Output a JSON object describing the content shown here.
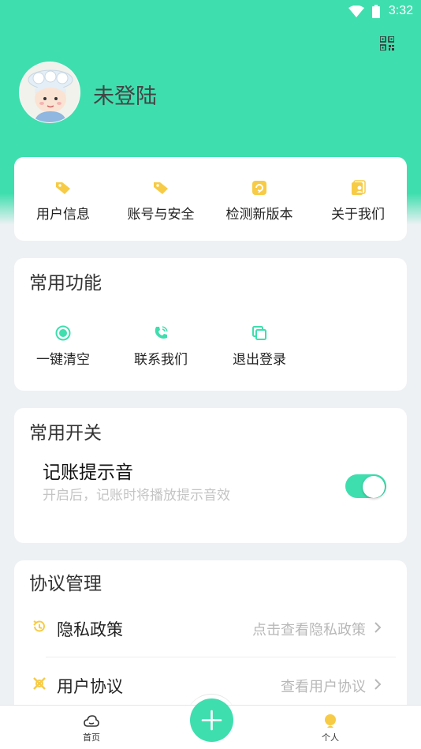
{
  "status_bar": {
    "time": "3:32"
  },
  "profile": {
    "login_status": "未登陆"
  },
  "quick_menu": {
    "items": [
      {
        "label": "用户信息",
        "icon": "tag-icon"
      },
      {
        "label": "账号与安全",
        "icon": "tag-icon"
      },
      {
        "label": "检测新版本",
        "icon": "update-icon"
      },
      {
        "label": "关于我们",
        "icon": "about-icon"
      }
    ]
  },
  "common_functions": {
    "title": "常用功能",
    "items": [
      {
        "label": "一键清空",
        "icon": "clear-icon"
      },
      {
        "label": "联系我们",
        "icon": "phone-icon"
      },
      {
        "label": "退出登录",
        "icon": "logout-icon"
      }
    ]
  },
  "common_switches": {
    "title": "常用开关",
    "setting_label": "记账提示音",
    "setting_desc": "开启后，记账时将播放提示音效",
    "enabled": true
  },
  "agreements": {
    "title": "协议管理",
    "items": [
      {
        "label": "隐私政策",
        "hint": "点击查看隐私政策",
        "icon": "history-icon"
      },
      {
        "label": "用户协议",
        "hint": "查看用户协议",
        "icon": "agreement-icon"
      }
    ]
  },
  "tabbar": {
    "home_label": "首页",
    "profile_label": "个人"
  },
  "colors": {
    "accent": "#3fdeae",
    "icon_yellow": "#f7cb45",
    "background": "#eef1f4"
  }
}
